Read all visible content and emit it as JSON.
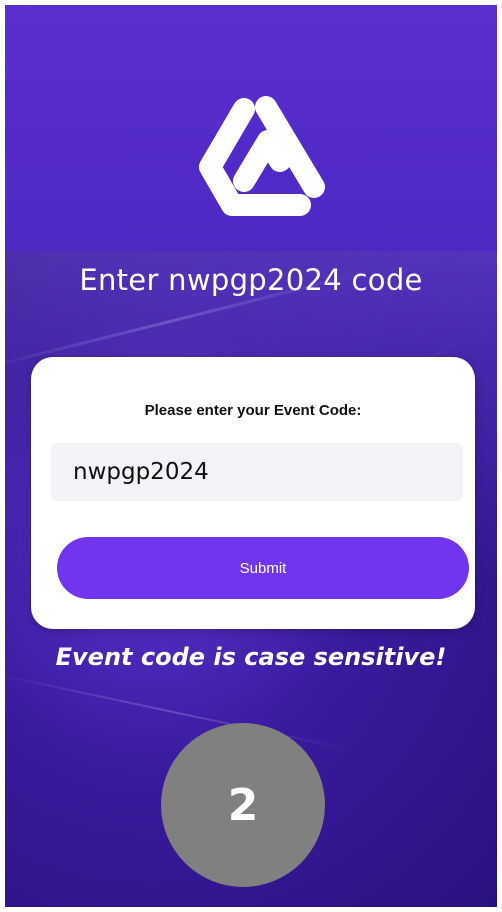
{
  "header": {
    "logo": "triangle-loop-logo",
    "title": "Enter nwpgp2024 code"
  },
  "card": {
    "label": "Please enter your Event Code:",
    "code_value": "nwpgp2024",
    "submit_label": "Submit"
  },
  "note": "Event code is case sensitive!",
  "step_number": "2",
  "colors": {
    "background": "#4a24b8",
    "header_band": "#5a2fd0",
    "accent": "#7235ef",
    "step_circle": "#808080"
  }
}
